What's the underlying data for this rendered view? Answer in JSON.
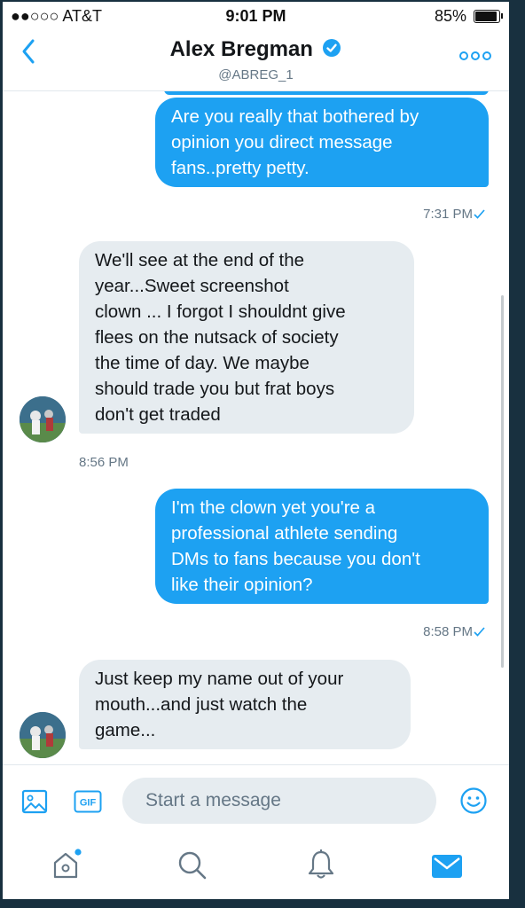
{
  "status_bar": {
    "carrier": "●●○○○ AT&T",
    "time": "9:01 PM",
    "battery": "85%"
  },
  "header": {
    "name": "Alex Bregman",
    "handle": "@ABREG_1"
  },
  "messages": [
    {
      "direction": "sent",
      "text": "Are you really that bothered by\nopinion you direct message\nfans..pretty petty.",
      "time": "7:31 PM"
    },
    {
      "direction": "received",
      "text": "We'll see at the end of the\nyear...Sweet screenshot\nclown ... I forgot I shouldnt give\nflees on the nutsack of society\nthe time of day. We maybe\nshould trade you but frat boys\ndon't get traded",
      "time": "8:56 PM"
    },
    {
      "direction": "sent",
      "text": "I'm the clown yet you're a\nprofessional athlete sending\nDMs to fans because you don't\nlike their opinion?",
      "time": "8:58 PM"
    },
    {
      "direction": "received",
      "text": "Just keep my name out of your\nmouth...and just watch the\ngame..."
    }
  ],
  "composer": {
    "placeholder": "Start a message",
    "gif_label": "GIF"
  },
  "icons": {
    "back": "chevron-left-icon",
    "verified": "verified-badge-icon",
    "more": "more-options-icon",
    "image": "image-icon",
    "gif": "gif-icon",
    "emoji": "emoji-icon",
    "home": "home-icon",
    "search": "search-icon",
    "notifications": "bell-icon",
    "messages": "mail-icon"
  },
  "colors": {
    "accent": "#1da1f2",
    "received_bubble": "#e6ecf0",
    "muted_text": "#657786"
  }
}
